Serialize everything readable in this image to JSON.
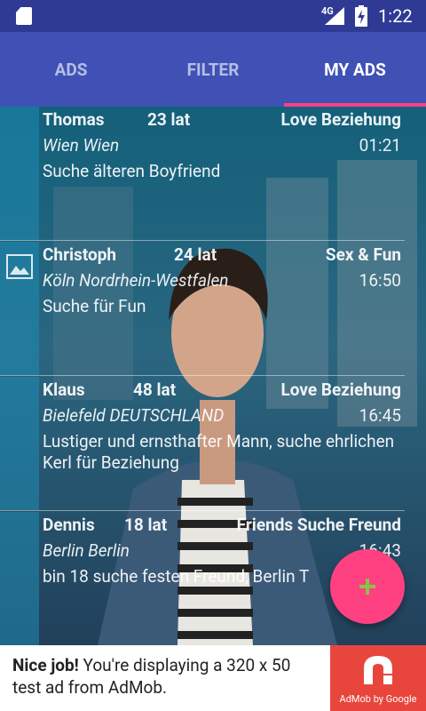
{
  "status_bar": {
    "network": "4G",
    "time": "1:22"
  },
  "tabs": [
    {
      "label": "ADS",
      "active": false
    },
    {
      "label": "FILTER",
      "active": false
    },
    {
      "label": "MY ADS",
      "active": true
    }
  ],
  "ads": [
    {
      "name": "Thomas",
      "age": "23 lat",
      "category": "Love Beziehung",
      "location": "Wien Wien",
      "time": "01:21",
      "text": "Suche älteren Boyfriend",
      "has_image": false
    },
    {
      "name": "Christoph",
      "age": "24 lat",
      "category": "Sex & Fun",
      "location": "Köln Nordrhein-Westfalen",
      "time": "16:50",
      "text": "Suche für Fun",
      "has_image": true
    },
    {
      "name": "Klaus",
      "age": "48 lat",
      "category": "Love Beziehung",
      "location": "Bielefeld DEUTSCHLAND",
      "time": "16:45",
      "text": "Lustiger und ernsthafter Mann, suche ehrlichen Kerl für Beziehung",
      "has_image": false
    },
    {
      "name": "Dennis",
      "age": "18 lat",
      "category": "Friends Suche Freund",
      "location": "Berlin Berlin",
      "time": "16:43",
      "text": "bin 18 suche festen Freund, Berlin T",
      "has_image": false
    }
  ],
  "fab": {
    "icon": "plus-icon"
  },
  "banner": {
    "bold": "Nice job!",
    "text": " You're displaying a 320 x 50 test ad from AdMob.",
    "caption": "AdMob by Google"
  },
  "colors": {
    "primary": "#3f51b5",
    "status": "#2f3a95",
    "accent": "#ff4081",
    "admob": "#e8463d"
  }
}
